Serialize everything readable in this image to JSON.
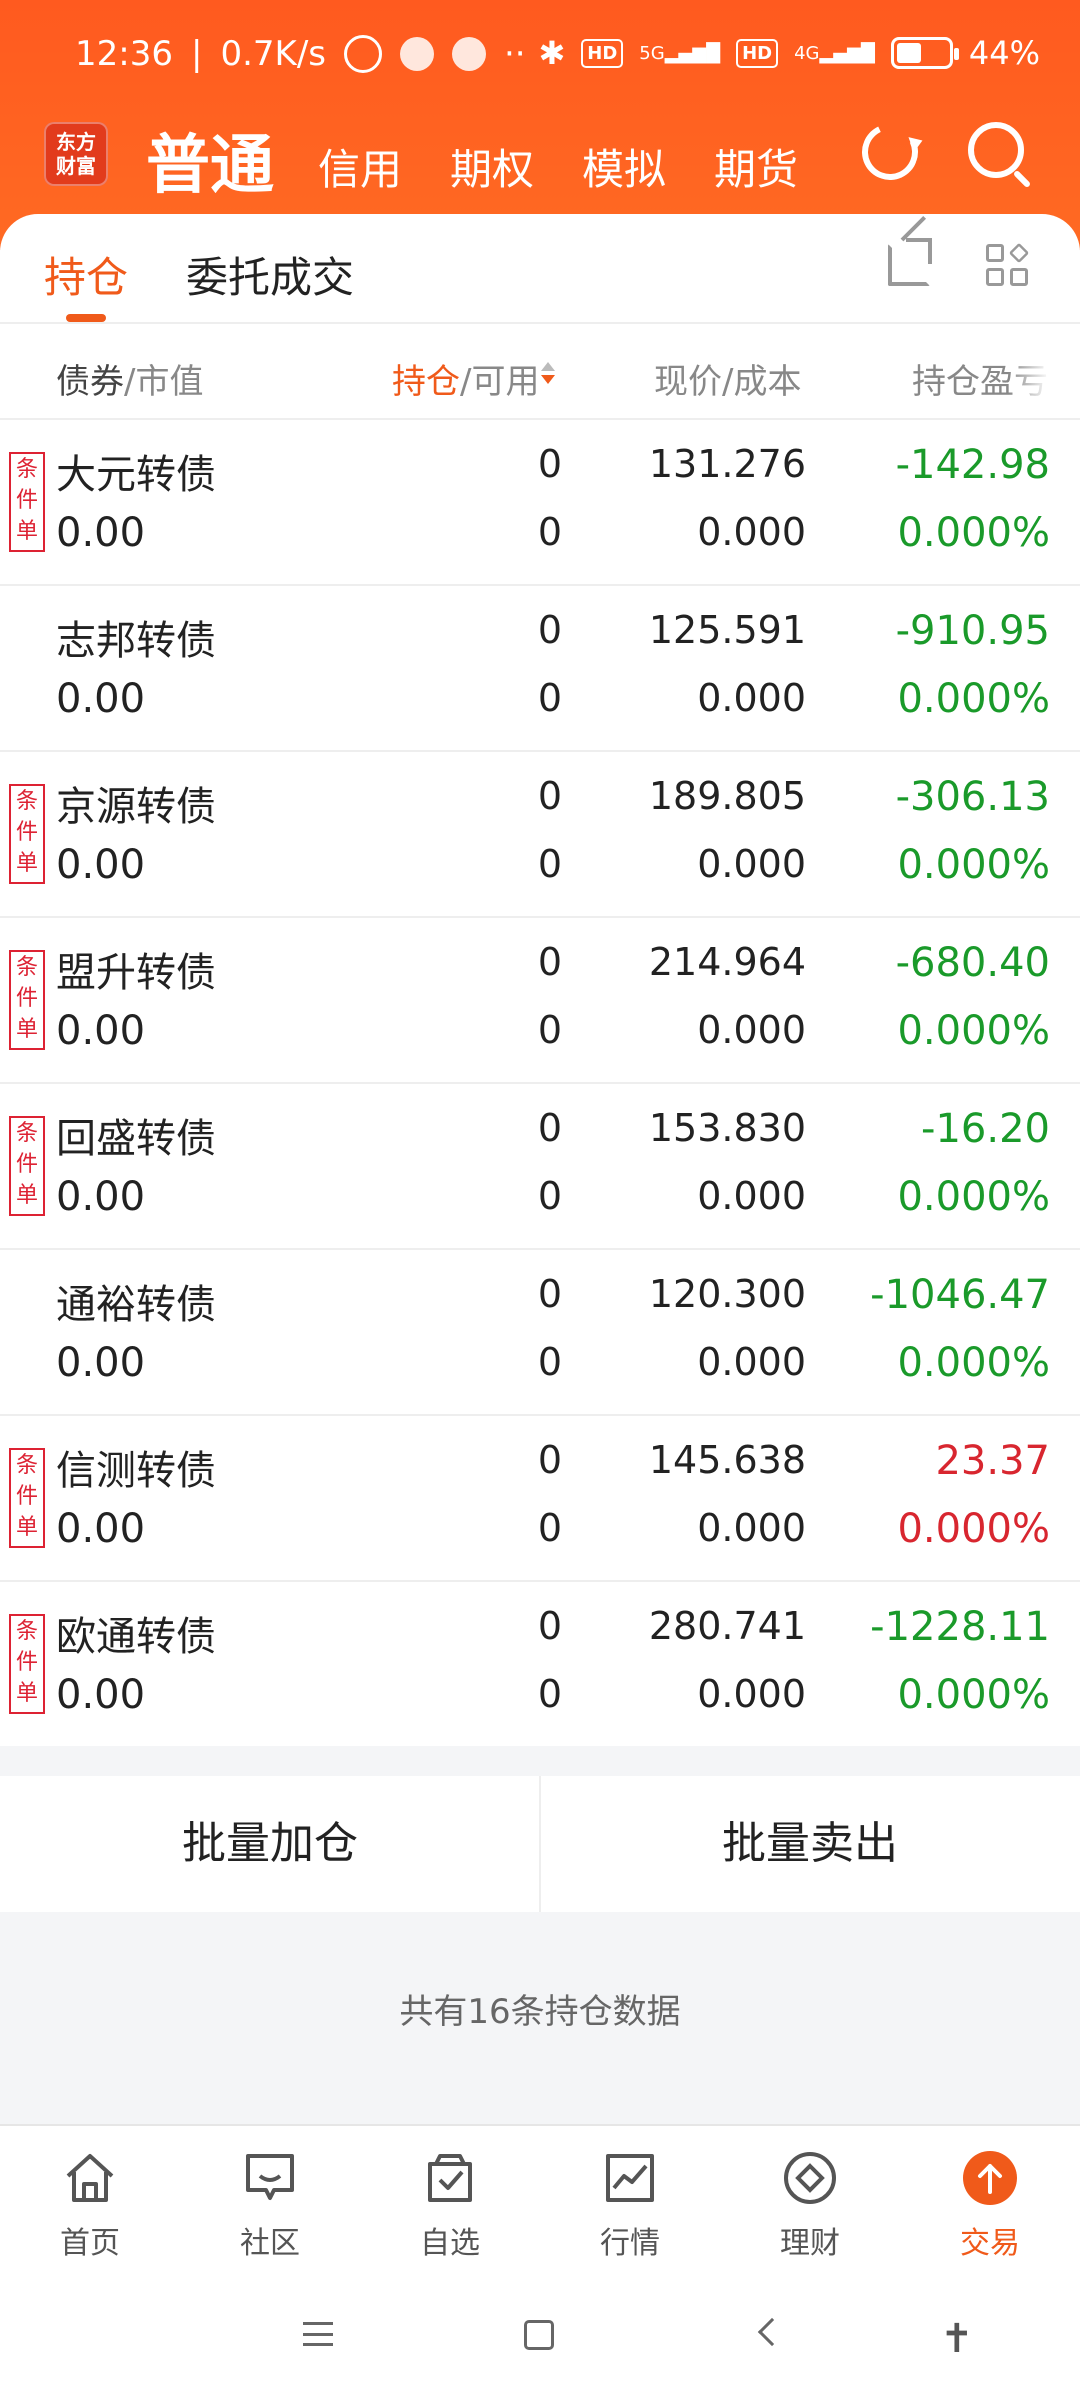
{
  "status_bar": {
    "time": "12:36",
    "net_speed": "0.7K/s",
    "hd_label": "HD",
    "net_5g": "5G",
    "net_4g": "4G",
    "battery": "44%"
  },
  "header": {
    "logo_line1": "东方",
    "logo_line2": "财富",
    "main_tab": "普通",
    "tabs": [
      "信用",
      "期权",
      "模拟",
      "期货"
    ]
  },
  "subtabs": {
    "active": "持仓",
    "other": "委托成交"
  },
  "columns": {
    "bond": "债券",
    "market_value": "/市值",
    "holding": "持仓",
    "available": "/可用",
    "price_cost": "现价/成本",
    "pnl": "持仓盈亏"
  },
  "condition_tag": "条件单",
  "rows": [
    {
      "name": "大元转债",
      "mv": "0.00",
      "hold": "0",
      "avail": "0",
      "price": "131.276",
      "cost": "0.000",
      "pl": "-142.98",
      "plp": "0.000%",
      "cond": true,
      "color": "#1a9a2a"
    },
    {
      "name": "志邦转债",
      "mv": "0.00",
      "hold": "0",
      "avail": "0",
      "price": "125.591",
      "cost": "0.000",
      "pl": "-910.95",
      "plp": "0.000%",
      "cond": false,
      "color": "#1a9a2a"
    },
    {
      "name": "京源转债",
      "mv": "0.00",
      "hold": "0",
      "avail": "0",
      "price": "189.805",
      "cost": "0.000",
      "pl": "-306.13",
      "plp": "0.000%",
      "cond": true,
      "color": "#1a9a2a"
    },
    {
      "name": "盟升转债",
      "mv": "0.00",
      "hold": "0",
      "avail": "0",
      "price": "214.964",
      "cost": "0.000",
      "pl": "-680.40",
      "plp": "0.000%",
      "cond": true,
      "color": "#1a9a2a"
    },
    {
      "name": "回盛转债",
      "mv": "0.00",
      "hold": "0",
      "avail": "0",
      "price": "153.830",
      "cost": "0.000",
      "pl": "-16.20",
      "plp": "0.000%",
      "cond": true,
      "color": "#1a9a2a"
    },
    {
      "name": "通裕转债",
      "mv": "0.00",
      "hold": "0",
      "avail": "0",
      "price": "120.300",
      "cost": "0.000",
      "pl": "-1046.47",
      "plp": "0.000%",
      "cond": false,
      "color": "#1a9a2a"
    },
    {
      "name": "信测转债",
      "mv": "0.00",
      "hold": "0",
      "avail": "0",
      "price": "145.638",
      "cost": "0.000",
      "pl": "23.37",
      "plp": "0.000%",
      "cond": true,
      "color": "#d8262f"
    },
    {
      "name": "欧通转债",
      "mv": "0.00",
      "hold": "0",
      "avail": "0",
      "price": "280.741",
      "cost": "0.000",
      "pl": "-1228.11",
      "plp": "0.000%",
      "cond": true,
      "color": "#1a9a2a"
    }
  ],
  "actions": {
    "batch_add": "批量加仓",
    "batch_sell": "批量卖出"
  },
  "summary": "共有16条持仓数据",
  "bottom_nav": [
    {
      "label": "首页",
      "icon": "home-icon"
    },
    {
      "label": "社区",
      "icon": "chat-icon"
    },
    {
      "label": "自选",
      "icon": "checklist-icon"
    },
    {
      "label": "行情",
      "icon": "chart-icon"
    },
    {
      "label": "理财",
      "icon": "diamond-icon"
    },
    {
      "label": "交易",
      "icon": "trade-arrow-icon"
    }
  ],
  "colors": {
    "accent": "#f05a1a",
    "gain": "#d8262f",
    "loss": "#1a9a2a"
  }
}
